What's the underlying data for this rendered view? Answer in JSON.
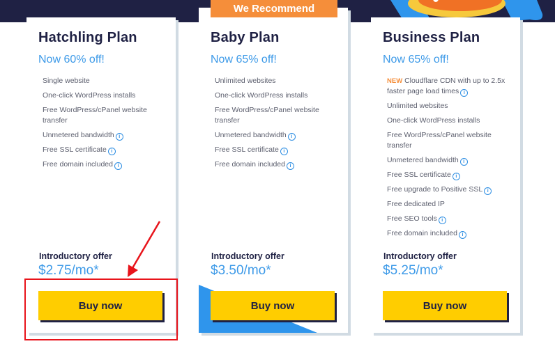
{
  "ribbon": {
    "label": "We Recommend"
  },
  "colors": {
    "navy": "#1f2144",
    "accent_blue": "#3d9ae8",
    "orange": "#f58e3a",
    "button_yellow": "#ffcd00",
    "annotation_red": "#e8141b"
  },
  "plans": [
    {
      "title": "Hatchling Plan",
      "discount": "Now 60% off!",
      "features": [
        {
          "text": "Single website",
          "info": false
        },
        {
          "text": "One-click WordPress installs",
          "info": false
        },
        {
          "text": "Free WordPress/cPanel website transfer",
          "info": false
        },
        {
          "text": "Unmetered bandwidth",
          "info": true
        },
        {
          "text": "Free SSL certificate",
          "info": true
        },
        {
          "text": "Free domain included",
          "info": true
        }
      ],
      "intro_label": "Introductory offer",
      "price": "$2.75/mo*",
      "button_label": "Buy now"
    },
    {
      "title": "Baby Plan",
      "discount": "Now 65% off!",
      "features": [
        {
          "text": "Unlimited websites",
          "info": false
        },
        {
          "text": "One-click WordPress installs",
          "info": false
        },
        {
          "text": "Free WordPress/cPanel website transfer",
          "info": false
        },
        {
          "text": "Unmetered bandwidth",
          "info": true
        },
        {
          "text": "Free SSL certificate",
          "info": true
        },
        {
          "text": "Free domain included",
          "info": true
        }
      ],
      "intro_label": "Introductory offer",
      "price": "$3.50/mo*",
      "button_label": "Buy now"
    },
    {
      "title": "Business Plan",
      "discount": "Now 65% off!",
      "features": [
        {
          "new_tag": "NEW",
          "text": "Cloudflare CDN with up to 2.5x faster page load times",
          "info": true
        },
        {
          "text": "Unlimited websites",
          "info": false
        },
        {
          "text": "One-click WordPress installs",
          "info": false
        },
        {
          "text": "Free WordPress/cPanel website transfer",
          "info": false
        },
        {
          "text": "Unmetered bandwidth",
          "info": true
        },
        {
          "text": "Free SSL certificate",
          "info": true
        },
        {
          "text": "Free upgrade to Positive SSL",
          "info": true
        },
        {
          "text": "Free dedicated IP",
          "info": false
        },
        {
          "text": "Free SEO tools",
          "info": true
        },
        {
          "text": "Free domain included",
          "info": true
        }
      ],
      "intro_label": "Introductory offer",
      "price": "$5.25/mo*",
      "button_label": "Buy now"
    }
  ],
  "info_icon_glyph": "i"
}
